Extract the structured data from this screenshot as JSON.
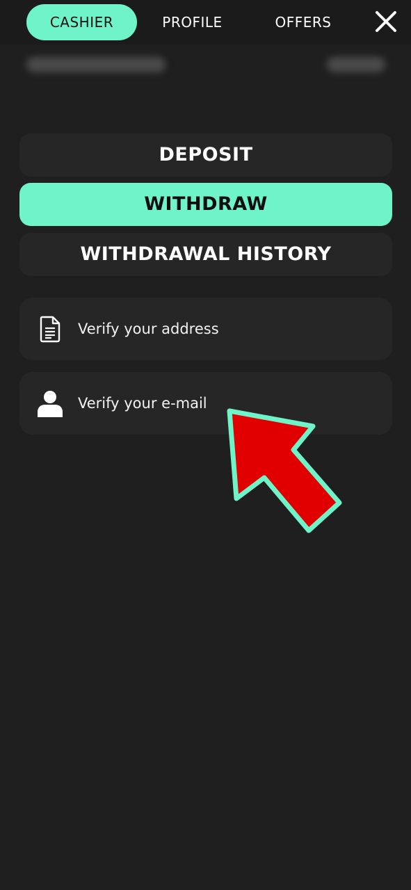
{
  "header": {
    "tabs": [
      {
        "label": "CASHIER",
        "active": true
      },
      {
        "label": "PROFILE",
        "active": false
      },
      {
        "label": "OFFERS",
        "active": false
      }
    ],
    "close_icon": "close-icon"
  },
  "account": {
    "id_text": "",
    "balance_text": ""
  },
  "menu": {
    "deposit_label": "DEPOSIT",
    "withdraw_label": "WITHDRAW",
    "history_label": "WITHDRAWAL HISTORY"
  },
  "verify": [
    {
      "label": "Verify your address",
      "icon": "document-icon"
    },
    {
      "label": "Verify your e-mail",
      "icon": "user-icon"
    }
  ],
  "colors": {
    "accent": "#6ff3c8",
    "background": "#1f1f1f",
    "card": "#262626",
    "annotation_arrow": "#e00000"
  }
}
